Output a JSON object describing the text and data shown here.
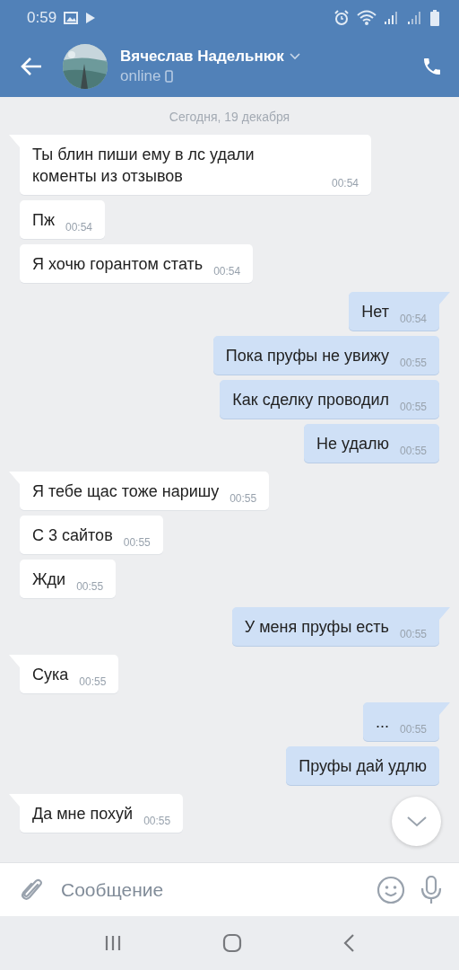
{
  "status_bar": {
    "time": "0:59"
  },
  "header": {
    "name": "Вячеслав Надельнюк",
    "status": "online"
  },
  "date_divider": "Сегодня, 19 декабря",
  "messages": [
    {
      "kind": "incoming",
      "tail": true,
      "text": "Ты блин пиши ему в лс удали коменты из отзывов",
      "time": "00:54"
    },
    {
      "kind": "incoming",
      "tail": false,
      "text": "Пж",
      "time": "00:54"
    },
    {
      "kind": "incoming",
      "tail": false,
      "text": "Я хочю горантом стать",
      "time": "00:54"
    },
    {
      "kind": "outgoing",
      "tail": true,
      "text": "Нет",
      "time": "00:54"
    },
    {
      "kind": "outgoing",
      "tail": false,
      "text": "Пока пруфы не увижу",
      "time": "00:55"
    },
    {
      "kind": "outgoing",
      "tail": false,
      "text": "Как сделку проводил",
      "time": "00:55"
    },
    {
      "kind": "outgoing",
      "tail": false,
      "text": "Не удалю",
      "time": "00:55"
    },
    {
      "kind": "incoming",
      "tail": true,
      "text": "Я тебе щас тоже наришу",
      "time": "00:55"
    },
    {
      "kind": "incoming",
      "tail": false,
      "text": "С 3 сайтов",
      "time": "00:55"
    },
    {
      "kind": "incoming",
      "tail": false,
      "text": "Жди",
      "time": "00:55"
    },
    {
      "kind": "outgoing",
      "tail": true,
      "text": "У меня пруфы есть",
      "time": "00:55"
    },
    {
      "kind": "incoming",
      "tail": true,
      "text": "Сука",
      "time": "00:55"
    },
    {
      "kind": "outgoing",
      "tail": true,
      "text": "...",
      "time": "00:55"
    },
    {
      "kind": "outgoing",
      "tail": false,
      "text": "Пруфы дай удлю"
    },
    {
      "kind": "incoming",
      "tail": true,
      "text": "Да мне похуй",
      "time": "00:55"
    }
  ],
  "composer": {
    "placeholder": "Сообщение"
  }
}
